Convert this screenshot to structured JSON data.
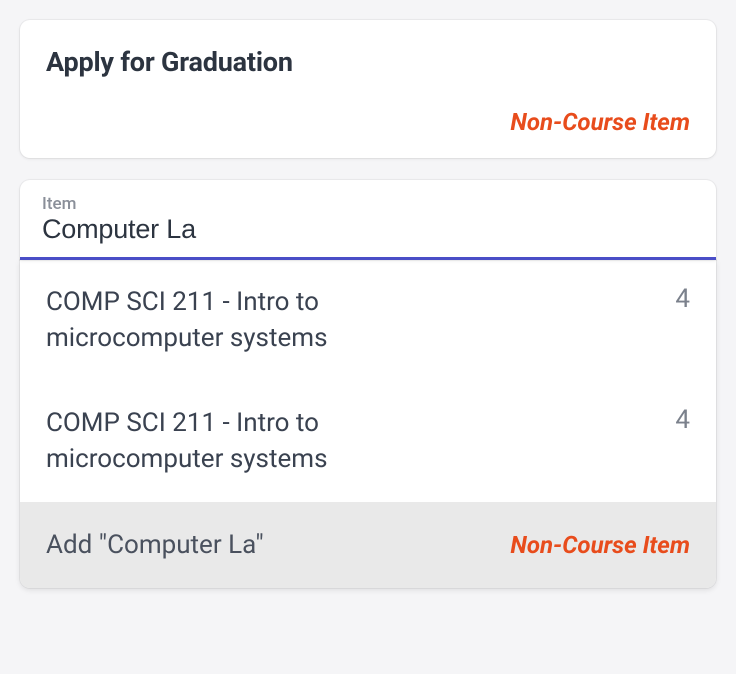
{
  "selected_card": {
    "title": "Apply for Graduation",
    "badge": "Non-Course Item"
  },
  "search": {
    "label": "Item",
    "value": "Computer La"
  },
  "suggestions": [
    {
      "title": "COMP SCI 211 - Intro to microcomputer systems",
      "credits": "4"
    },
    {
      "title": "COMP SCI 211 - Intro to microcomputer systems",
      "credits": "4"
    }
  ],
  "add_option": {
    "label": "Add \"Computer La\"",
    "badge": "Non-Course Item"
  }
}
